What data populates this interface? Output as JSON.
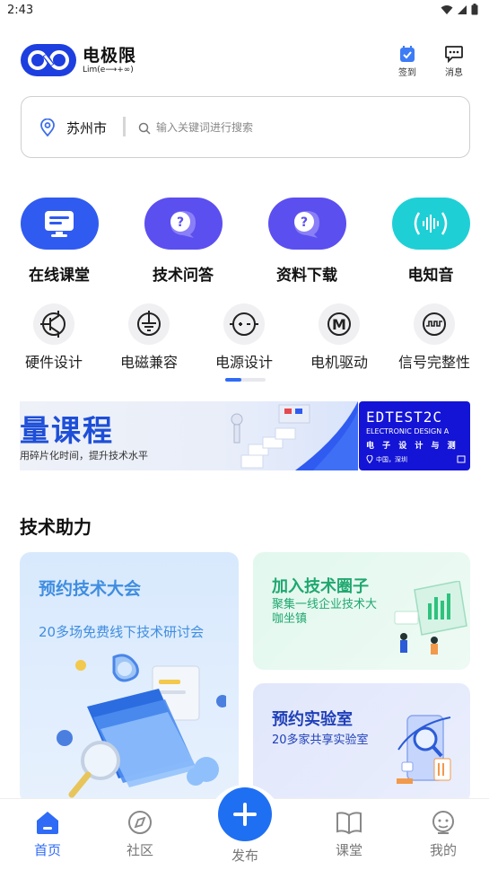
{
  "status_bar": {
    "time": "2:43"
  },
  "header": {
    "logo_name": "电极限",
    "logo_sub": "Lim(e⟶+∞)",
    "checkin_label": "签到",
    "message_label": "消息"
  },
  "search": {
    "city": "苏州市",
    "placeholder": "输入关键词进行搜索"
  },
  "main_nav": {
    "items": [
      {
        "label": "在线课堂",
        "icon": "monitor-icon",
        "color": "#2f5bf0"
      },
      {
        "label": "技术问答",
        "icon": "question-bubble-icon",
        "color": "#5b4ff0"
      },
      {
        "label": "资料下载",
        "icon": "question-bubble-icon",
        "color": "#5b4ff0"
      },
      {
        "label": "电知音",
        "icon": "sound-wave-icon",
        "color": "#1fcfd6"
      }
    ]
  },
  "sub_nav": {
    "items": [
      {
        "label": "硬件设计",
        "icon": "transistor-icon"
      },
      {
        "label": "电磁兼容",
        "icon": "ground-icon"
      },
      {
        "label": "电源设计",
        "icon": "power-source-icon"
      },
      {
        "label": "电机驱动",
        "icon": "motor-icon"
      },
      {
        "label": "信号完整性",
        "icon": "signal-icon"
      }
    ]
  },
  "banners": [
    {
      "title": "量课程",
      "subtitle": "用碎片化时间，提升技术水平"
    },
    {
      "title": "EDTEST2C",
      "line2": "ELECTRONIC DESIGN A",
      "line3": "电 子 设 计 与 测",
      "line4": "中国，深圳"
    }
  ],
  "section": {
    "title": "技术助力"
  },
  "cards": {
    "conference": {
      "title": "预约技术大会",
      "subtitle": "20多场免费线下技术研讨会"
    },
    "circle": {
      "title": "加入技术圈子",
      "subtitle": "聚集一线企业技术大咖坐镇"
    },
    "lab": {
      "title": "预约实验室",
      "subtitle": "20多家共享实验室"
    }
  },
  "tabbar": {
    "home": "首页",
    "community": "社区",
    "publish": "发布",
    "classroom": "课堂",
    "mine": "我的"
  }
}
